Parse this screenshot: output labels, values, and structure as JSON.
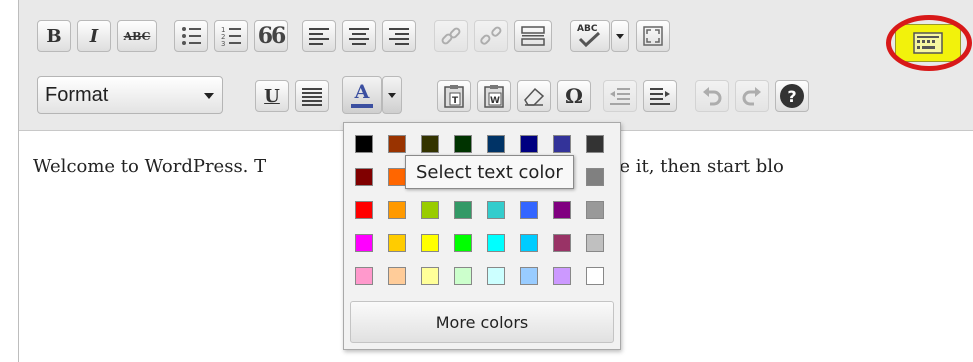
{
  "toolbar": {
    "row1": [
      {
        "name": "bold-button",
        "label": "B",
        "icon": "bold"
      },
      {
        "name": "italic-button",
        "label": "I",
        "icon": "italic"
      },
      {
        "name": "strikethrough-button",
        "label": "ABC",
        "icon": "strikethrough"
      },
      {
        "name": "bullet-list-button",
        "icon": "bullet-list-icon"
      },
      {
        "name": "numbered-list-button",
        "icon": "numbered-list-icon"
      },
      {
        "name": "blockquote-button",
        "label": "66",
        "icon": "quote-icon"
      },
      {
        "name": "align-left-button",
        "icon": "align-left-icon"
      },
      {
        "name": "align-center-button",
        "icon": "align-center-icon"
      },
      {
        "name": "align-right-button",
        "icon": "align-right-icon"
      },
      {
        "name": "insert-link-button",
        "icon": "link-icon"
      },
      {
        "name": "unlink-button",
        "icon": "unlink-icon"
      },
      {
        "name": "insert-more-button",
        "icon": "more-tag-icon"
      },
      {
        "name": "spellcheck-button",
        "label": "ABC",
        "icon": "spellcheck-icon"
      },
      {
        "name": "fullscreen-button",
        "icon": "fullscreen-icon"
      },
      {
        "name": "kitchen-sink-button",
        "icon": "kitchen-sink-icon"
      }
    ],
    "format_label": "Format",
    "underline_label": "U",
    "text_color_label": "A",
    "omega_label": "Ω",
    "help_label": "?"
  },
  "editor": {
    "content_left": "Welcome to WordPress. T",
    "content_right": "dit or delete it, then start blo"
  },
  "color_picker": {
    "colors": [
      [
        "#000000",
        "#993300",
        "#333300",
        "#003300",
        "#003366",
        "#000080",
        "#333399",
        "#333333"
      ],
      [
        "#800000",
        "#FF6600",
        "#808000",
        "#008000",
        "#008080",
        "#0000FF",
        "#666699",
        "#808080"
      ],
      [
        "#FF0000",
        "#FF9900",
        "#99CC00",
        "#339966",
        "#33CCCC",
        "#3366FF",
        "#800080",
        "#999999"
      ],
      [
        "#FF00FF",
        "#FFCC00",
        "#FFFF00",
        "#00FF00",
        "#00FFFF",
        "#00CCFF",
        "#993366",
        "#C0C0C0"
      ],
      [
        "#FF99CC",
        "#FFCC99",
        "#FFFF99",
        "#CCFFCC",
        "#CCFFFF",
        "#99CCFF",
        "#CC99FF",
        "#FFFFFF"
      ]
    ],
    "more_colors_label": "More colors"
  },
  "tooltip": {
    "text": "Select text color"
  },
  "colors": {
    "highlight_ring": "#d81919",
    "kitchen_sink_bg": "#f2f20c",
    "text_color_underline": "#3b4fa0"
  }
}
